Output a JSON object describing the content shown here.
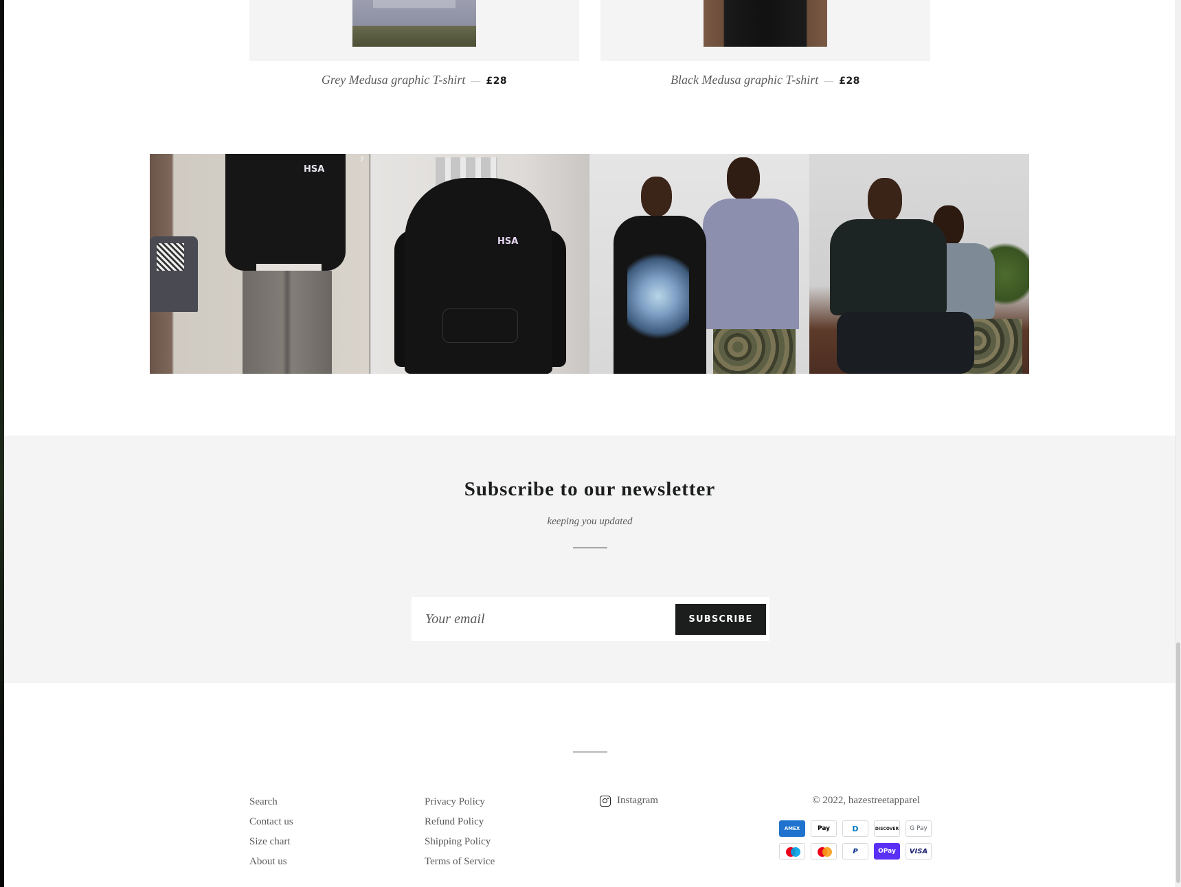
{
  "products": [
    {
      "name": "Grey Medusa graphic T-shirt",
      "separator": "—",
      "price": "£28"
    },
    {
      "name": "Black Medusa graphic T-shirt",
      "separator": "—",
      "price": "£28"
    }
  ],
  "gallery": {
    "tiles": [
      {
        "logo_text": "HSA",
        "corner_count": "7"
      },
      {
        "logo_text": "HSA"
      },
      {},
      {}
    ]
  },
  "newsletter": {
    "title": "Subscribe to our newsletter",
    "subtitle": "keeping you updated",
    "email_placeholder": "Your email",
    "button_label": "SUBSCRIBE"
  },
  "footer": {
    "links_col1": [
      "Search",
      "Contact us",
      "Size chart",
      "About us"
    ],
    "links_col2": [
      "Privacy Policy",
      "Refund Policy",
      "Shipping Policy",
      "Terms of Service"
    ],
    "social": {
      "label": "Instagram",
      "icon": "instagram-icon"
    },
    "copyright": "© 2022, hazestreetapparel",
    "payments": [
      {
        "name": "American Express",
        "label": "AMEX",
        "icon": "amex-icon"
      },
      {
        "name": "Apple Pay",
        "label": " Pay",
        "icon": "apple-pay-icon"
      },
      {
        "name": "Diners Club",
        "label": "D",
        "icon": "diners-club-icon"
      },
      {
        "name": "Discover",
        "label": "DISCOVER",
        "icon": "discover-icon"
      },
      {
        "name": "Google Pay",
        "label": "G Pay",
        "icon": "google-pay-icon"
      },
      {
        "name": "Maestro",
        "icon": "maestro-icon"
      },
      {
        "name": "Mastercard",
        "icon": "mastercard-icon"
      },
      {
        "name": "PayPal",
        "label": "P",
        "icon": "paypal-icon"
      },
      {
        "name": "Shop Pay",
        "label": "OPay",
        "icon": "shop-pay-icon"
      },
      {
        "name": "Visa",
        "label": "VISA",
        "icon": "visa-icon"
      }
    ]
  },
  "colors": {
    "text": "#1c1d1d",
    "muted": "#5a5a5a",
    "section_bg": "#f4f4f4",
    "button_bg": "#1c1d1d"
  }
}
